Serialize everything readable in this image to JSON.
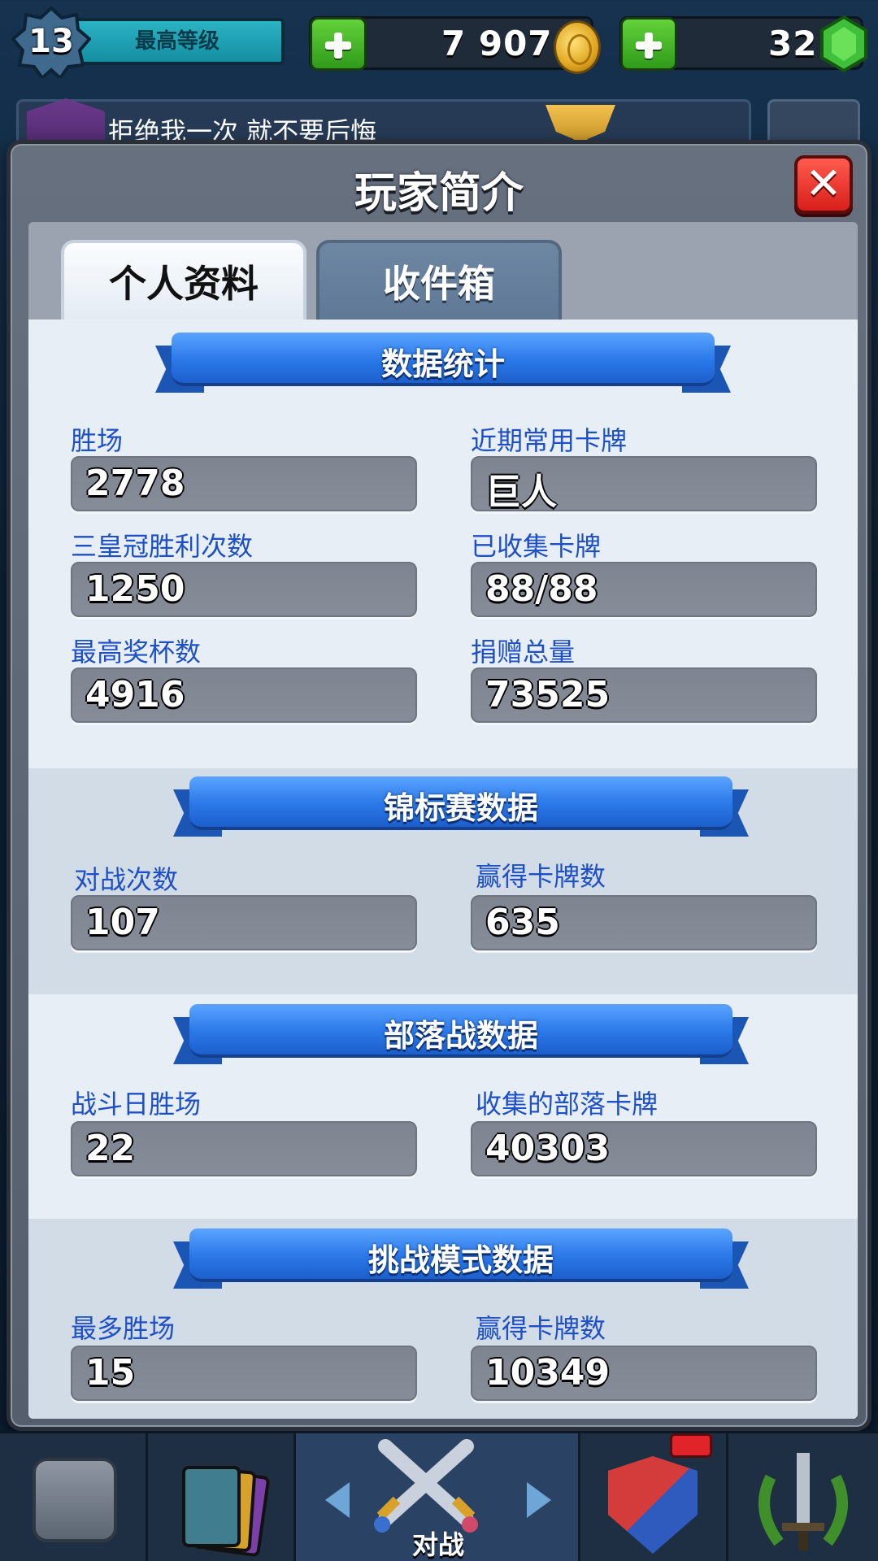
{
  "hud": {
    "level": "13",
    "level_label": "最高等级",
    "gold": "7 907",
    "gems": "32"
  },
  "profile_row": {
    "player_name": "拒绝我一次 就不要后悔"
  },
  "dialog": {
    "title": "玩家简介",
    "close_icon": "close-icon",
    "tabs": [
      {
        "label": "个人资料",
        "active": true
      },
      {
        "label": "收件箱",
        "active": false
      }
    ]
  },
  "sections": [
    {
      "title": "数据统计",
      "stats": [
        {
          "label": "胜场",
          "value": "2778"
        },
        {
          "label": "近期常用卡牌",
          "value": "巨人"
        },
        {
          "label": "三皇冠胜利次数",
          "value": "1250"
        },
        {
          "label": "已收集卡牌",
          "value": "88/88"
        },
        {
          "label": "最高奖杯数",
          "value": "4916"
        },
        {
          "label": "捐赠总量",
          "value": "73525"
        }
      ]
    },
    {
      "title": "锦标赛数据",
      "stats": [
        {
          "label": "对战次数",
          "value": "107"
        },
        {
          "label": "赢得卡牌数",
          "value": "635"
        }
      ]
    },
    {
      "title": "部落战数据",
      "stats": [
        {
          "label": "战斗日胜场",
          "value": "22"
        },
        {
          "label": "收集的部落卡牌",
          "value": "40303"
        }
      ]
    },
    {
      "title": "挑战模式数据",
      "stats": [
        {
          "label": "最多胜场",
          "value": "15"
        },
        {
          "label": "赢得卡牌数",
          "value": "10349"
        }
      ]
    }
  ],
  "bottom_nav": {
    "items": [
      {
        "name": "shop",
        "icon": "chest-icon"
      },
      {
        "name": "cards",
        "icon": "cards-icon"
      },
      {
        "name": "battle",
        "icon": "crossed-swords-icon",
        "label": "对战"
      },
      {
        "name": "clan",
        "icon": "clan-shield-icon"
      },
      {
        "name": "tournaments",
        "icon": "laurel-sword-icon"
      }
    ]
  },
  "colors": {
    "ribbon_blue": "#2a78e8",
    "stat_label_blue": "#1d4fc7",
    "close_red": "#d81f1b",
    "plus_green": "#2f9a1a"
  }
}
